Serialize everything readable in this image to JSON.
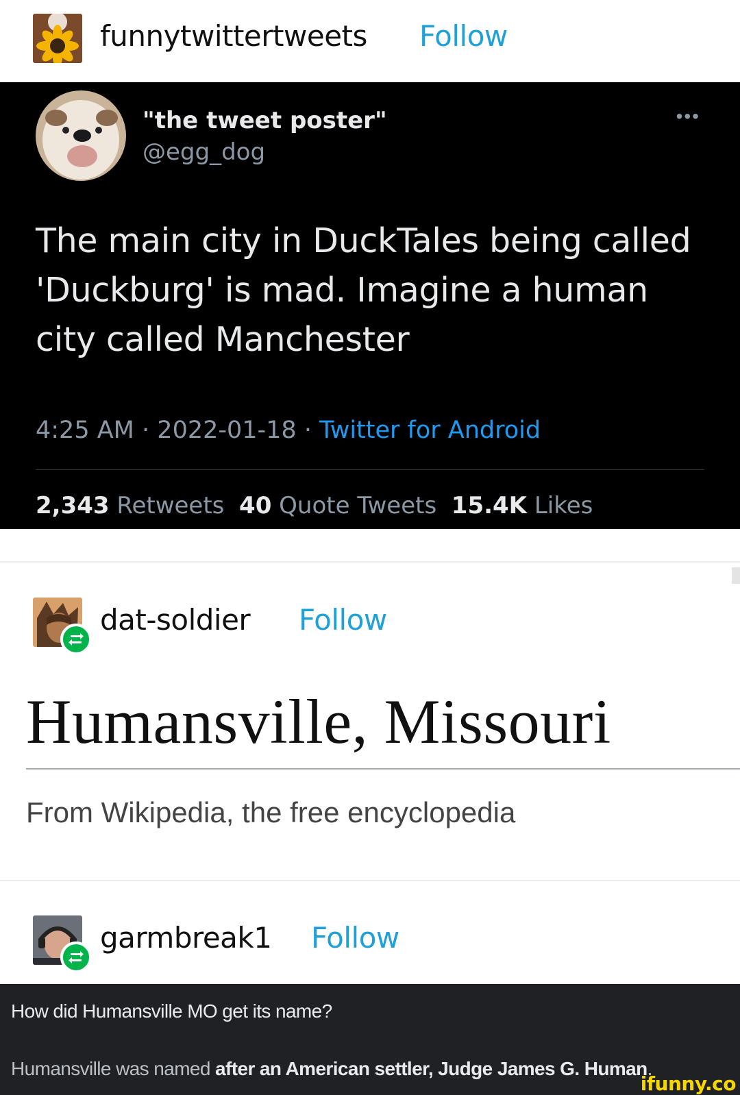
{
  "posts": [
    {
      "username": "funnytwittertweets",
      "follow_label": "Follow",
      "avatar_icon": "sunflower-avatar-icon"
    },
    {
      "username": "dat-soldier",
      "follow_label": "Follow",
      "avatar_icon": "character-avatar-icon",
      "reblog_icon": "reblog-icon"
    },
    {
      "username": "garmbreak1",
      "follow_label": "Follow",
      "avatar_icon": "person-avatar-icon",
      "reblog_icon": "reblog-icon"
    }
  ],
  "tweet": {
    "display_name": "\"the tweet poster\"",
    "handle": "@egg_dog",
    "more": "•••",
    "text_lines": [
      "The main city in DuckTales being called",
      "'Duckburg' is mad. Imagine a human",
      "city called Manchester"
    ],
    "time": "4:25 AM",
    "date": "2022-01-18",
    "separator": "·",
    "source": "Twitter for Android",
    "retweets_count": "2,343",
    "retweets_label": "Retweets",
    "quotes_count": "40",
    "quotes_label": "Quote Tweets",
    "likes_count": "15.4K",
    "likes_label": "Likes"
  },
  "wiki": {
    "title": "Humansville, Missouri",
    "subtitle": "From Wikipedia, the free encyclopedia"
  },
  "answer": {
    "question": "How did Humansville MO get its name?",
    "answer_plain": "Humansville was named ",
    "answer_bold": "after an American settler, Judge James G. Human",
    "answer_end": "."
  },
  "watermark": "ifunny.co",
  "colors": {
    "follow": "#1ea0d8",
    "reblog": "#00b34a",
    "tweet_bg": "#000000",
    "twitter_link": "#1d9bf0",
    "answer_bg": "#202124",
    "watermark": "#f7d600"
  }
}
